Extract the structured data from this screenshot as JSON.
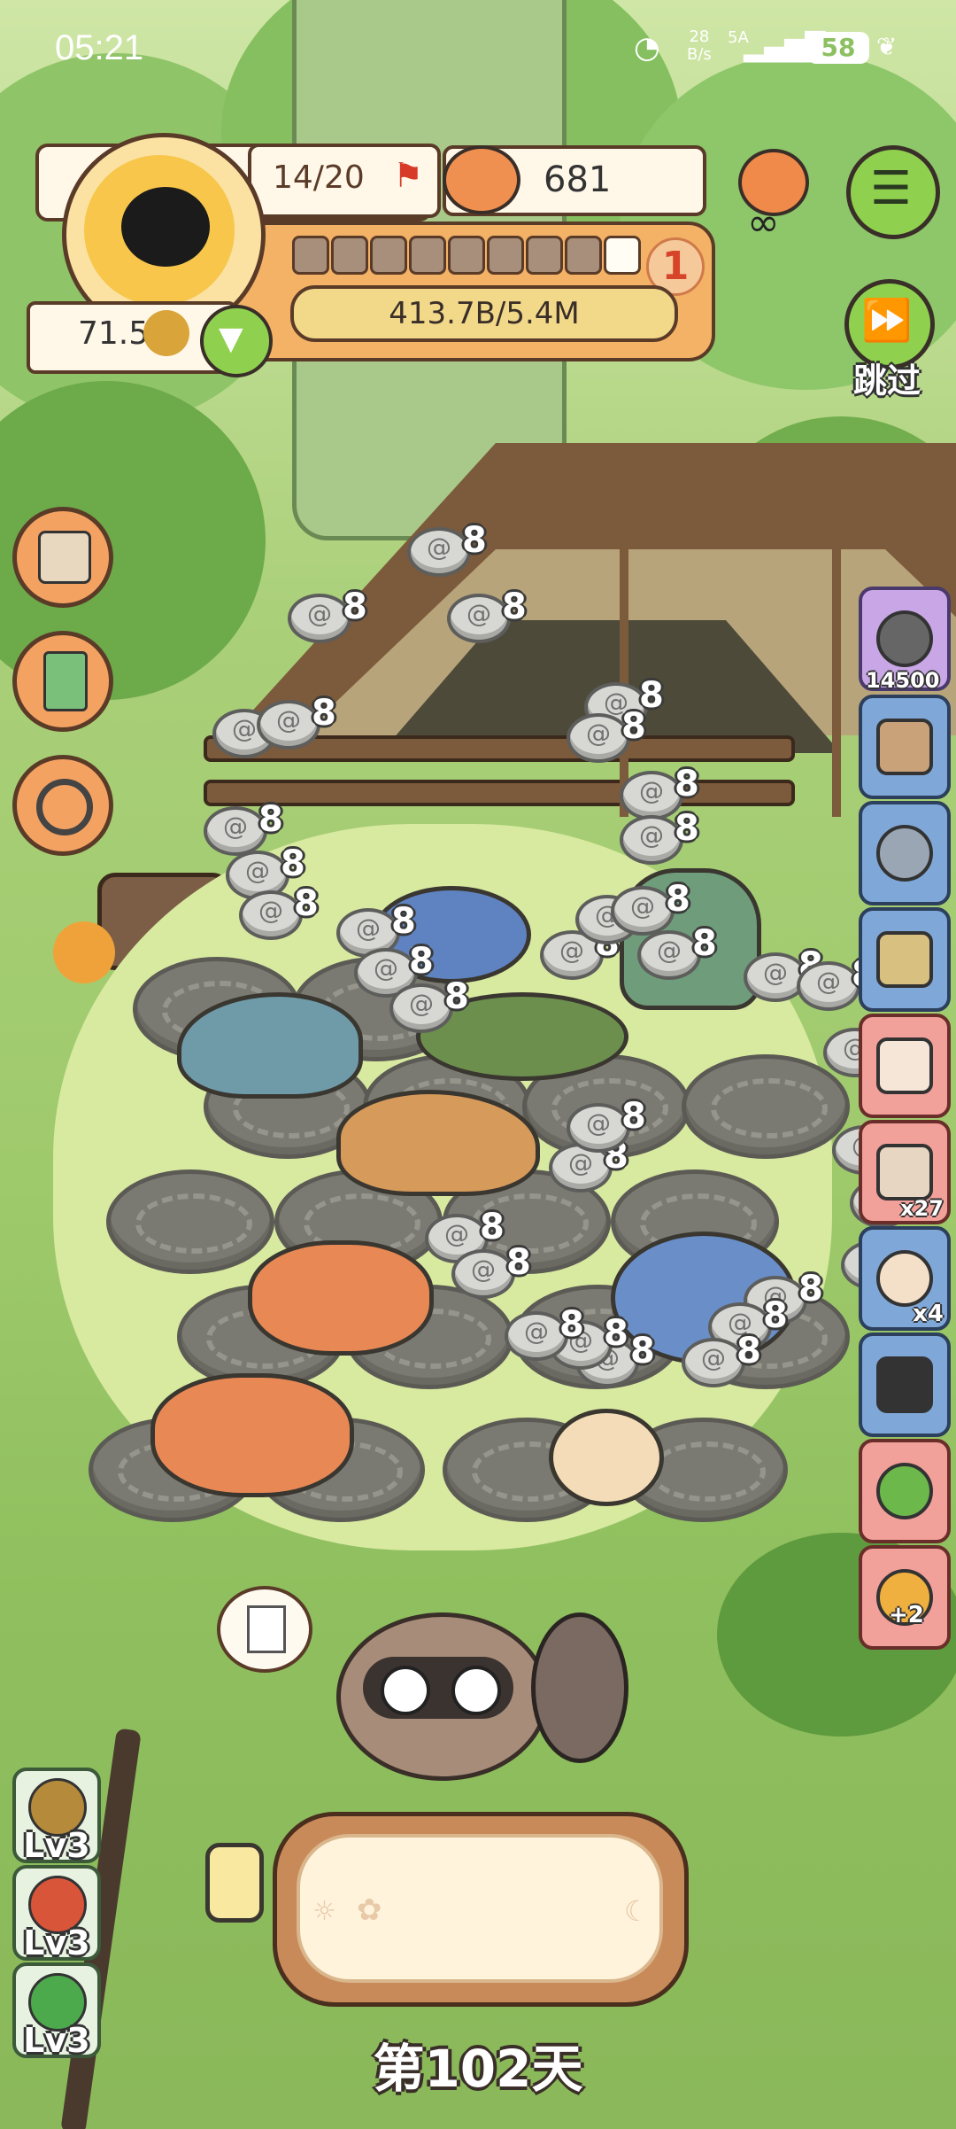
{
  "status_bar": {
    "time": "05:21",
    "net_speed_top": "28",
    "net_speed_unit": "B/s",
    "network": "5A",
    "battery": "58"
  },
  "hud": {
    "cat_capacity": "14/20",
    "food_count": "681",
    "level_progress_text": "413.7B/5.4M",
    "level_number": "1",
    "paw_value": "71.5",
    "progress_segments_filled": 9,
    "progress_segments_total": 9
  },
  "skip_button": {
    "label": "跳过"
  },
  "right_column": {
    "gem_count": "14500",
    "badge_x4": "x4",
    "badge_x27": "x27",
    "badge_plus2": "+2"
  },
  "left_column_level_buttons": [
    {
      "label": "Lv3",
      "icon": "skull-paw-icon"
    },
    {
      "label": "Lv3",
      "icon": "red-pot-icon"
    },
    {
      "label": "Lv3",
      "icon": "green-bag-icon"
    }
  ],
  "coin_bubbles_value": "8",
  "day_label": "第102天",
  "colors": {
    "hud_orange": "#f4b266",
    "hud_border": "#5a3b28",
    "progress_fill": "#f2d98a",
    "side_blue": "#7fa8d8",
    "side_red": "#f2a09a",
    "green_button": "#8fd14f"
  }
}
